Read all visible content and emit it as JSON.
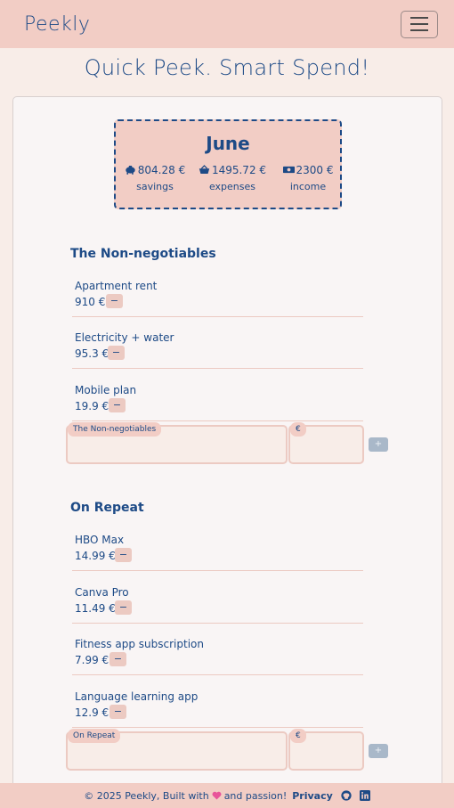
{
  "nav": {
    "brand": "Peekly",
    "menu_icon": "hamburger-menu-icon"
  },
  "tagline": "Quick Peek. Smart Spend!",
  "summary": {
    "month": "June",
    "savings": {
      "value": "804.28 €",
      "label": "savings",
      "icon": "piggy-bank-icon"
    },
    "expenses": {
      "value": "1495.72 €",
      "label": "expenses",
      "icon": "basket-icon"
    },
    "income": {
      "value": "2300 €",
      "label": "income",
      "icon": "cash-icon"
    }
  },
  "sections": [
    {
      "title": "The Non-negotiables",
      "items": [
        {
          "name": "Apartment rent",
          "amount": "910 €"
        },
        {
          "name": "Electricity + water",
          "amount": "95.3 €"
        },
        {
          "name": "Mobile plan",
          "amount": "19.9 €"
        }
      ],
      "name_label": "The Non-negotiables",
      "amount_label": "€",
      "minus": "−",
      "plus": "+"
    },
    {
      "title": "On Repeat",
      "items": [
        {
          "name": "HBO Max",
          "amount": "14.99 €"
        },
        {
          "name": "Canva Pro",
          "amount": "11.49 €"
        },
        {
          "name": "Fitness app subscription",
          "amount": "7.99 €"
        },
        {
          "name": "Language learning app",
          "amount": "12.9 €"
        }
      ],
      "name_label": "On Repeat",
      "amount_label": "€",
      "minus": "−",
      "plus": "+"
    }
  ],
  "footer": {
    "copyright": "© 2025 Peekly, Built with",
    "heart_icon": "heart-icon",
    "passion": "and passion!",
    "privacy": "Privacy",
    "github_icon": "github-icon",
    "linkedin_icon": "linkedin-icon"
  },
  "colors": {
    "primary": "#1d4a86",
    "nav_bg": "#f2cdc5",
    "page_bg": "#f8ede8",
    "heart": "#e8559a"
  }
}
